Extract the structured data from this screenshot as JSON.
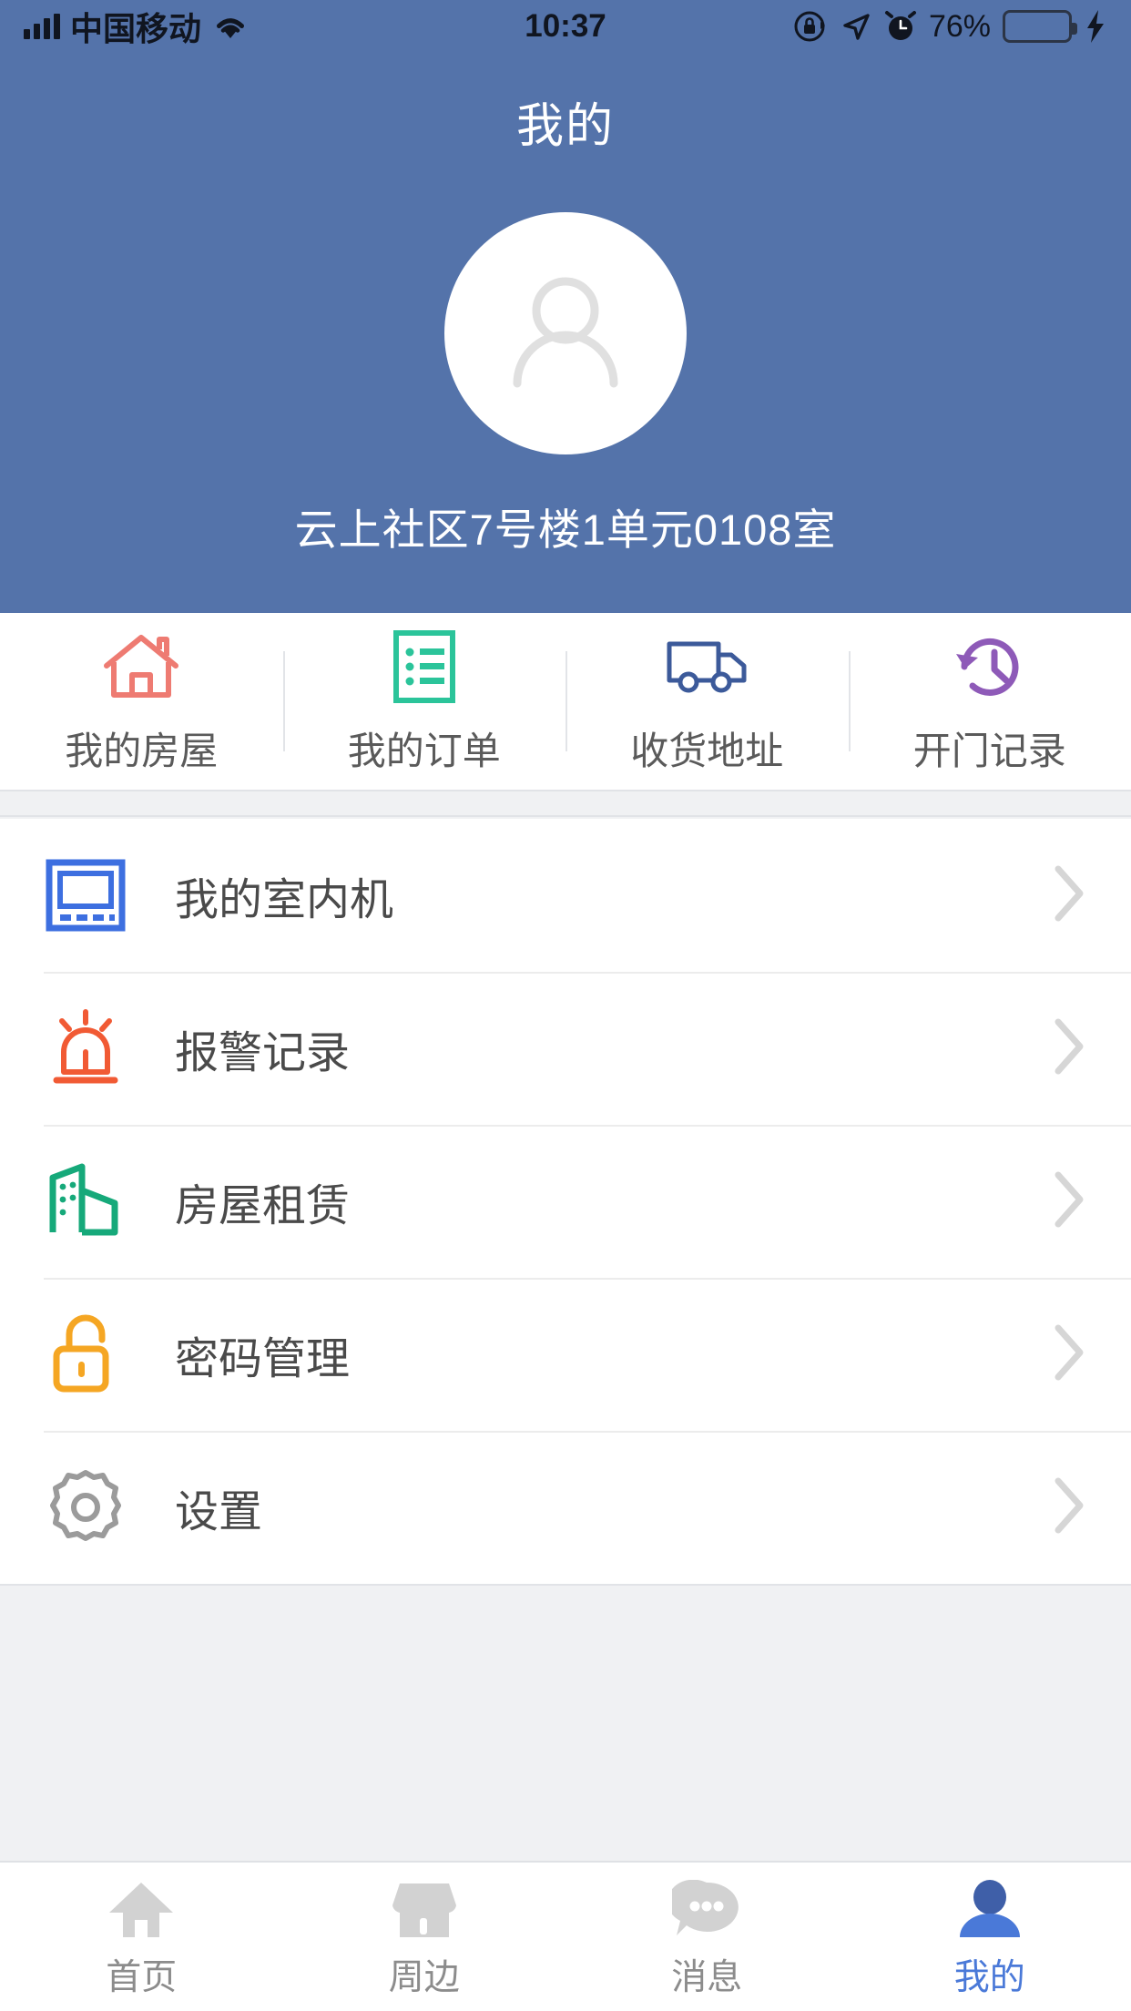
{
  "status_bar": {
    "carrier": "中国移动",
    "wifi_icon": "wifi-icon",
    "signal_icon": "signal-bars-icon",
    "time": "10:37",
    "rotation_lock_icon": "rotation-lock-icon",
    "location_icon": "location-arrow-icon",
    "alarm_icon": "alarm-clock-icon",
    "battery_percent": "76%",
    "battery_icon": "battery-icon",
    "charging_icon": "lightning-bolt-icon",
    "battery_level": 76,
    "battery_color": "#4CE05B"
  },
  "header": {
    "title": "我的",
    "avatar_icon": "default-user-avatar-icon",
    "address": "云上社区7号楼1单元0108室",
    "background_color": "#5473AA"
  },
  "quick_actions": [
    {
      "label": "我的房屋",
      "icon": "house-outline-icon",
      "color": "#EE7B72"
    },
    {
      "label": "我的订单",
      "icon": "order-list-icon",
      "color": "#2BC49A"
    },
    {
      "label": "收货地址",
      "icon": "delivery-truck-icon",
      "color": "#3C5A9A"
    },
    {
      "label": "开门记录",
      "icon": "history-clock-icon",
      "color": "#8E5AB8"
    }
  ],
  "menu": [
    {
      "label": "我的室内机",
      "icon": "indoor-monitor-icon",
      "color": "#3D6FE0",
      "chevron": "chevron-right-icon"
    },
    {
      "label": "报警记录",
      "icon": "alarm-siren-icon",
      "color": "#F15A34",
      "chevron": "chevron-right-icon"
    },
    {
      "label": "房屋租赁",
      "icon": "building-rental-icon",
      "color": "#16A97A",
      "chevron": "chevron-right-icon"
    },
    {
      "label": "密码管理",
      "icon": "unlocked-padlock-icon",
      "color": "#F5A623",
      "chevron": "chevron-right-icon"
    },
    {
      "label": "设置",
      "icon": "gear-icon",
      "color": "#9B9B9B",
      "chevron": "chevron-right-icon"
    }
  ],
  "tabbar": {
    "active_color": "#4A79D8",
    "inactive_color": "#D2D2D2",
    "items": [
      {
        "label": "首页",
        "icon": "home-icon",
        "active": false
      },
      {
        "label": "周边",
        "icon": "shop-icon",
        "active": false
      },
      {
        "label": "消息",
        "icon": "chat-bubble-icon",
        "active": false
      },
      {
        "label": "我的",
        "icon": "person-icon",
        "active": true
      }
    ]
  }
}
